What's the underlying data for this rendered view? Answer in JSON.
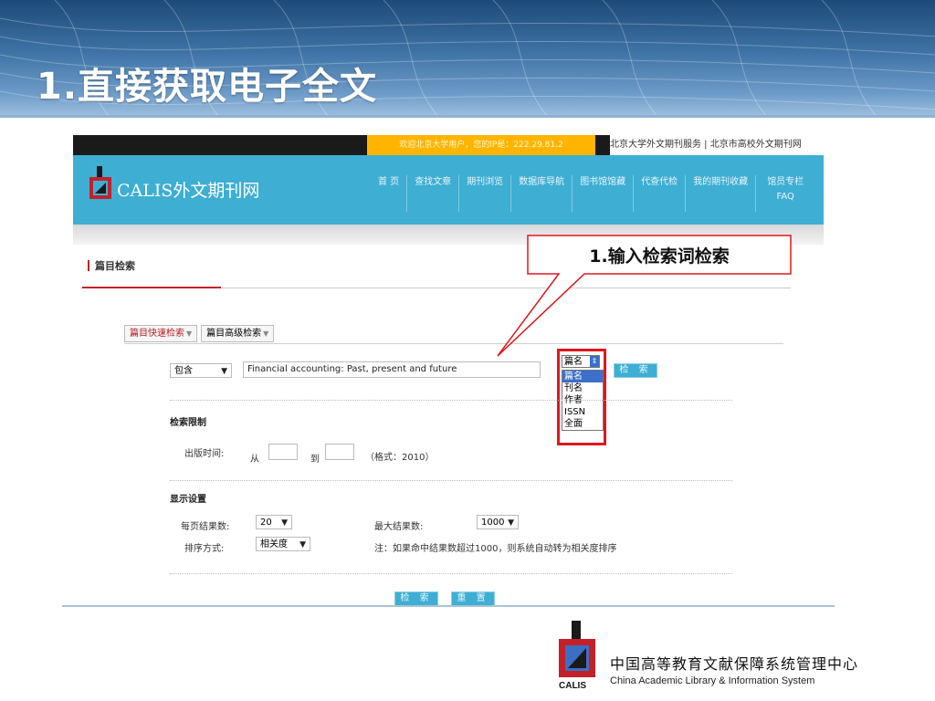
{
  "slide": {
    "title": "1.直接获取电子全文"
  },
  "site": {
    "welcome": "欢迎北京大学用户，您的IP是：222.29.81.2",
    "top_links": "北京大学外文期刊服务 | 北京市高校外文期刊网",
    "logo_text": "CALIS外文期刊网",
    "nav": [
      {
        "label": "首 页"
      },
      {
        "label": "查找文章"
      },
      {
        "label": "期刊浏览"
      },
      {
        "label": "数据库导航"
      },
      {
        "label": "图书馆馆藏"
      },
      {
        "label": "代查代检"
      },
      {
        "label": "我的期刊收藏"
      },
      {
        "label": "馆员专栏 FAQ"
      }
    ]
  },
  "search": {
    "section_title": "篇目检索",
    "tabs": [
      {
        "label": "篇目快速检索"
      },
      {
        "label": "篇目高级检索"
      }
    ],
    "match_mode": "包含",
    "query": "Financial accounting: Past, present and future",
    "field_selected": "篇名",
    "field_options": [
      "篇名",
      "刊名",
      "作者",
      "ISSN",
      "全面"
    ],
    "search_button": "检 索",
    "limit_heading": "检索限制",
    "pub_time_label": "出版时间:",
    "from_label": "从",
    "to_label": "到",
    "format_hint": "（格式：2010）",
    "display_heading": "显示设置",
    "per_page_label": "每页结果数:",
    "per_page_value": "20",
    "max_results_label": "最大结果数:",
    "max_results_value": "1000",
    "sort_label": "排序方式:",
    "sort_value": "相关度",
    "note": "注：如果命中结果数超过1000，则系统自动转为相关度排序",
    "submit_button": "检 索",
    "reset_button": "重 置"
  },
  "callout": {
    "text": "1.输入检索词检索"
  },
  "footer": {
    "org_cn": "中国高等教育文献保障系统管理中心",
    "org_en": "China Academic Library & Information System",
    "logo_word": "CALIS"
  },
  "colors": {
    "accent": "#3eaed3",
    "highlight": "#e0161e",
    "welcome_bg": "#ffb500"
  }
}
